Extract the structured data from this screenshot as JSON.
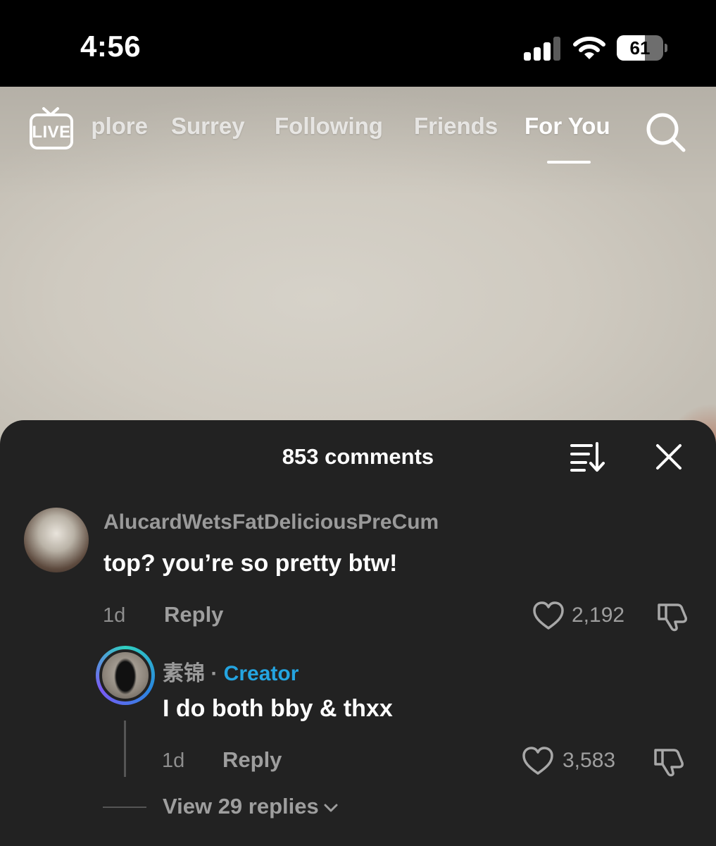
{
  "status_bar": {
    "time": "4:56",
    "battery_level": "61",
    "battery_fraction": 0.61,
    "signal_bars": 3,
    "icons": [
      "cellular-signal-icon",
      "wifi-icon",
      "battery-icon"
    ]
  },
  "top_nav": {
    "live_label": "LIVE",
    "tabs": [
      {
        "label": "Explore",
        "visible_text": "plore"
      },
      {
        "label": "Surrey"
      },
      {
        "label": "Following"
      },
      {
        "label": "Friends"
      },
      {
        "label": "For You",
        "active": true
      }
    ],
    "search_icon": "search-icon"
  },
  "comments_sheet": {
    "title": "853 comments",
    "sort_icon": "sort-icon",
    "close_icon": "close-icon",
    "comment": {
      "username": "AlucardWetsFatDeliciousPreCum",
      "text": "top? you’re so pretty btw!",
      "time": "1d",
      "reply_label": "Reply",
      "likes": "2,192"
    },
    "reply": {
      "username": "素锦",
      "separator": " · ",
      "badge": "Creator",
      "text": "I do both bby & thxx",
      "time": "1d",
      "reply_label": "Reply",
      "likes": "3,583"
    },
    "view_replies": "View 29 replies"
  },
  "colors": {
    "sheet_background": "#222222",
    "creator_badge": "#24a4e0",
    "muted_text": "#9e9e9e"
  }
}
